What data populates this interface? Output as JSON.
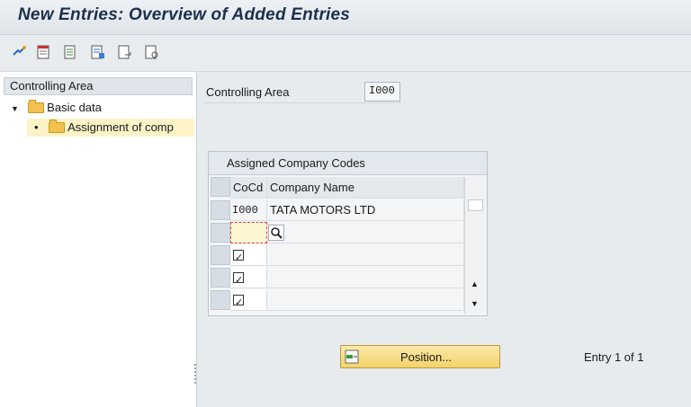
{
  "title": "New Entries: Overview of Added Entries",
  "toolbar": {
    "icons": [
      "display-change-icon",
      "new-entries-icon",
      "copy-icon",
      "delete-icon",
      "undo-icon",
      "select-all-icon"
    ]
  },
  "tree": {
    "header": "Controlling Area",
    "items": [
      {
        "label": "Basic data",
        "expanded": true
      },
      {
        "label": "Assignment of comp",
        "selected": true
      }
    ]
  },
  "form": {
    "controlling_area_label": "Controlling Area",
    "controlling_area_value": "I000"
  },
  "table": {
    "title": "Assigned Company Codes",
    "columns": [
      "CoCd",
      "Company Name"
    ],
    "rows": [
      {
        "cocd": "I000",
        "name": "TATA MOTORS LTD"
      },
      {
        "cocd": "",
        "name": ""
      },
      {
        "cocd": "",
        "name": ""
      },
      {
        "cocd": "",
        "name": ""
      },
      {
        "cocd": "",
        "name": ""
      }
    ]
  },
  "position_button": "Position...",
  "entry_text": "Entry 1 of 1",
  "colors": {
    "title": "#1c2f4c",
    "button": "#f4d36a",
    "folder": "#f2c14e"
  }
}
